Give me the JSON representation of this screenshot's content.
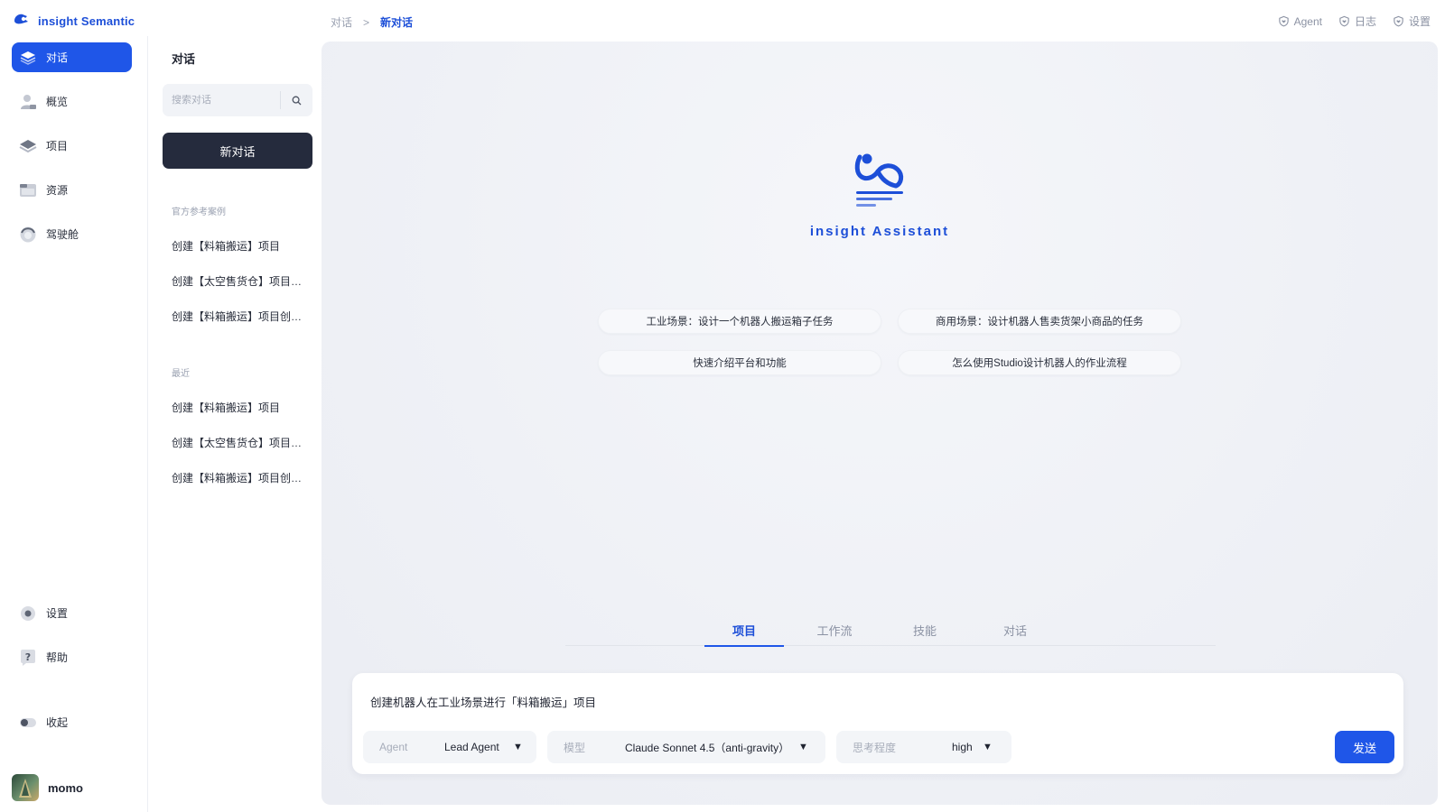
{
  "app": {
    "brand": "insight Semantic"
  },
  "breadcrumb": {
    "parent": "对话",
    "separator": ">",
    "current": "新对话"
  },
  "top_links": [
    {
      "label": "Agent",
      "icon": "shield-heart-icon"
    },
    {
      "label": "日志",
      "icon": "shield-heart-icon"
    },
    {
      "label": "设置",
      "icon": "shield-heart-icon"
    }
  ],
  "sidebar": {
    "items": [
      {
        "label": "对话",
        "icon": "layers-icon",
        "active": true
      },
      {
        "label": "概览",
        "icon": "user-card-icon"
      },
      {
        "label": "项目",
        "icon": "stack-icon"
      },
      {
        "label": "资源",
        "icon": "folder-icon"
      },
      {
        "label": "驾驶舱",
        "icon": "gauge-icon"
      }
    ],
    "bottom_items": [
      {
        "label": "设置",
        "icon": "gear-icon"
      },
      {
        "label": "帮助",
        "icon": "help-icon"
      },
      {
        "label": "收起",
        "icon": "collapse-icon"
      }
    ],
    "user": {
      "name": "momo"
    }
  },
  "conversations": {
    "title": "对话",
    "search_placeholder": "搜索对话",
    "new_button": "新对话",
    "official_label": "官方参考案例",
    "official": [
      "创建【料箱搬运】项目",
      "创建【太空售货仓】项目的复杂版本",
      "创建【料箱搬运】项目创建流程"
    ],
    "recent_label": "最近",
    "recent": [
      "创建【料箱搬运】项目",
      "创建【太空售货仓】项目的复杂版本",
      "创建【料箱搬运】项目创建流程"
    ]
  },
  "main": {
    "assistant_name": "insight Assistant",
    "suggestions": [
      "工业场景：设计一个机器人搬运箱子任务",
      "商用场景：设计机器人售卖货架小商品的任务",
      "快速介绍平台和功能",
      "怎么使用Studio设计机器人的作业流程"
    ],
    "tabs": [
      "项目",
      "工作流",
      "技能",
      "对话"
    ],
    "active_tab": 0,
    "composer": {
      "text": "创建机器人在工业场景进行「料箱搬运」项目",
      "agent_label": "Agent",
      "agent_value": "Lead Agent",
      "model_label": "模型",
      "model_value": "Claude Sonnet 4.5（anti-gravity）",
      "thinking_label": "思考程度",
      "thinking_value": "high",
      "send_label": "发送"
    }
  },
  "colors": {
    "accent": "#1f56e8",
    "brand_text": "#1d4fd8",
    "dark_button": "#252b3d"
  }
}
